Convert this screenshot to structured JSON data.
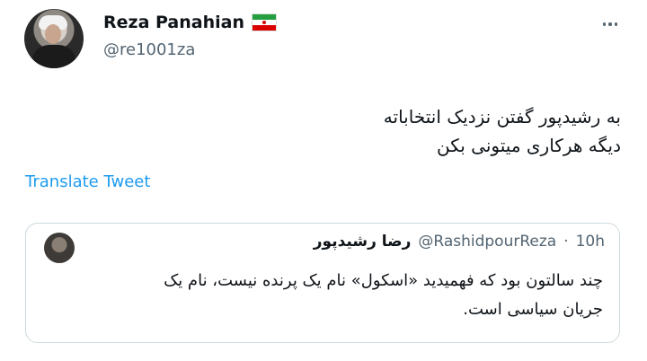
{
  "author": {
    "name": "Reza Panahian",
    "handle": "@re1001za",
    "flag_icon": "iran-flag-icon"
  },
  "tweet": {
    "lines": [
      "به رشیدپور گفتن نزدیک انتخاباته",
      "دیگه هرکاری میتونی بکن"
    ],
    "translate_label": "Translate Tweet"
  },
  "quoted_tweet": {
    "name": "رضا رشیدپور",
    "handle": "@RashidpourReza",
    "separator": "·",
    "time": "10h",
    "lines": [
      "چند سالتون بود که فهمیدید «اسکول» نام یک پرنده نیست، نام یک",
      "جریان سیاسی است."
    ]
  },
  "colors": {
    "link": "#1d9bf0",
    "secondary_text": "#536471",
    "border": "#cfd9de"
  }
}
